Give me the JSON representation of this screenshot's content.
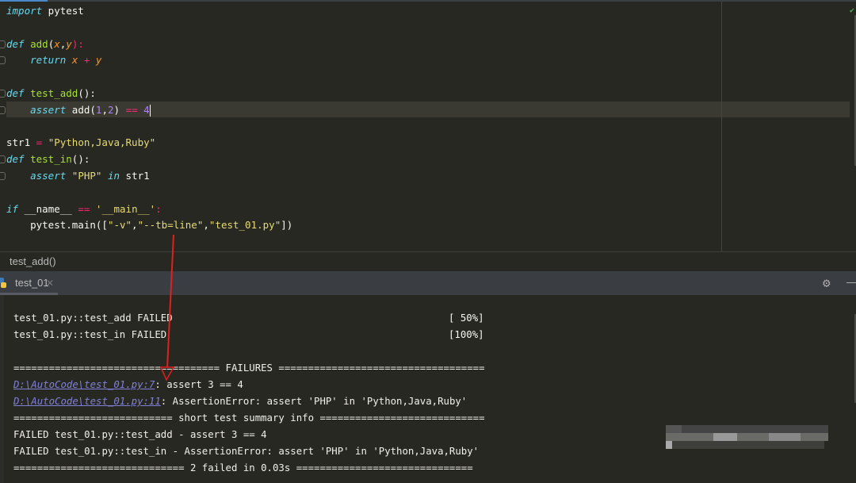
{
  "editor": {
    "lines": [
      [
        [
          "import",
          "kw"
        ],
        [
          " pytest",
          "tx"
        ]
      ],
      [],
      [
        [
          "def",
          "kw"
        ],
        [
          " ",
          "tx"
        ],
        [
          "add",
          "fn"
        ],
        [
          "(",
          "tx"
        ],
        [
          "x",
          "pa"
        ],
        [
          ",",
          "tx"
        ],
        [
          "y",
          "pa"
        ],
        [
          "):",
          "op"
        ]
      ],
      [
        [
          "    ",
          "tx"
        ],
        [
          "return",
          "kw"
        ],
        [
          " ",
          "tx"
        ],
        [
          "x",
          "pa"
        ],
        [
          " + ",
          "op"
        ],
        [
          "y",
          "pa"
        ]
      ],
      [],
      [
        [
          "def",
          "kw"
        ],
        [
          " ",
          "tx"
        ],
        [
          "test_add",
          "fn"
        ],
        [
          "():",
          "tx"
        ]
      ],
      [
        [
          "    ",
          "tx"
        ],
        [
          "assert",
          "kw"
        ],
        [
          " add(",
          "tx"
        ],
        [
          "1",
          "nu"
        ],
        [
          ",",
          "tx"
        ],
        [
          "2",
          "nu"
        ],
        [
          ") ",
          "tx"
        ],
        [
          "==",
          "op"
        ],
        [
          " ",
          "tx"
        ],
        [
          "4",
          "nu"
        ]
      ],
      [],
      [
        [
          "str1 ",
          "tx"
        ],
        [
          "=",
          "op"
        ],
        [
          " ",
          "tx"
        ],
        [
          "\"Python,Java,Ruby\"",
          "st"
        ]
      ],
      [
        [
          "def",
          "kw"
        ],
        [
          " ",
          "tx"
        ],
        [
          "test_in",
          "fn"
        ],
        [
          "():",
          "tx"
        ]
      ],
      [
        [
          "    ",
          "tx"
        ],
        [
          "assert",
          "kw"
        ],
        [
          " ",
          "tx"
        ],
        [
          "\"PHP\"",
          "st"
        ],
        [
          " ",
          "tx"
        ],
        [
          "in",
          "kw"
        ],
        [
          " str1",
          "tx"
        ]
      ],
      [],
      [
        [
          "if",
          "kw"
        ],
        [
          " __name__ ",
          "tx"
        ],
        [
          "==",
          "op"
        ],
        [
          " ",
          "tx"
        ],
        [
          "'__main__'",
          "st"
        ],
        [
          ":",
          "op"
        ]
      ],
      [
        [
          "    pytest.main([",
          "tx"
        ],
        [
          "\"-v\"",
          "st"
        ],
        [
          ",",
          "tx"
        ],
        [
          "\"--tb=line\"",
          "st"
        ],
        [
          ",",
          "tx"
        ],
        [
          "\"test_01.py\"",
          "st"
        ],
        [
          "])",
          "tx"
        ]
      ]
    ],
    "current_line": 7
  },
  "breadcrumb": "test_add()",
  "run_panel": {
    "tab_label": "test_01",
    "tab_icon": "python-icon",
    "settings_icon": "gear-icon",
    "close_icon": "close-icon",
    "minimize_icon": "minimize-icon"
  },
  "console": {
    "results": [
      {
        "text": "test_01.py::test_add FAILED",
        "pct": "[ 50%]"
      },
      {
        "text": "test_01.py::test_in FAILED",
        "pct": "[100%]"
      }
    ],
    "failures_header": "=================================== FAILURES ===================================",
    "failures": [
      {
        "link": "D:\\AutoCode\\test_01.py:7",
        "message": ": assert 3 == 4"
      },
      {
        "link": "D:\\AutoCode\\test_01.py:11",
        "message": ": AssertionError: assert 'PHP' in 'Python,Java,Ruby'"
      }
    ],
    "summary_header": "=========================== short test summary info ============================",
    "summary": [
      "FAILED test_01.py::test_add - assert 3 == 4",
      "FAILED test_01.py::test_in - AssertionError: assert 'PHP' in 'Python,Java,Ruby'"
    ],
    "footer": "============================= 2 failed in 0.03s =============================="
  },
  "colors": {
    "annotation_arrow": "#e02020",
    "keyword": "#66d9ef",
    "function": "#a6e22e",
    "string": "#e6db74",
    "operator": "#f92672",
    "number": "#ae81ff",
    "link": "#8080d8"
  }
}
